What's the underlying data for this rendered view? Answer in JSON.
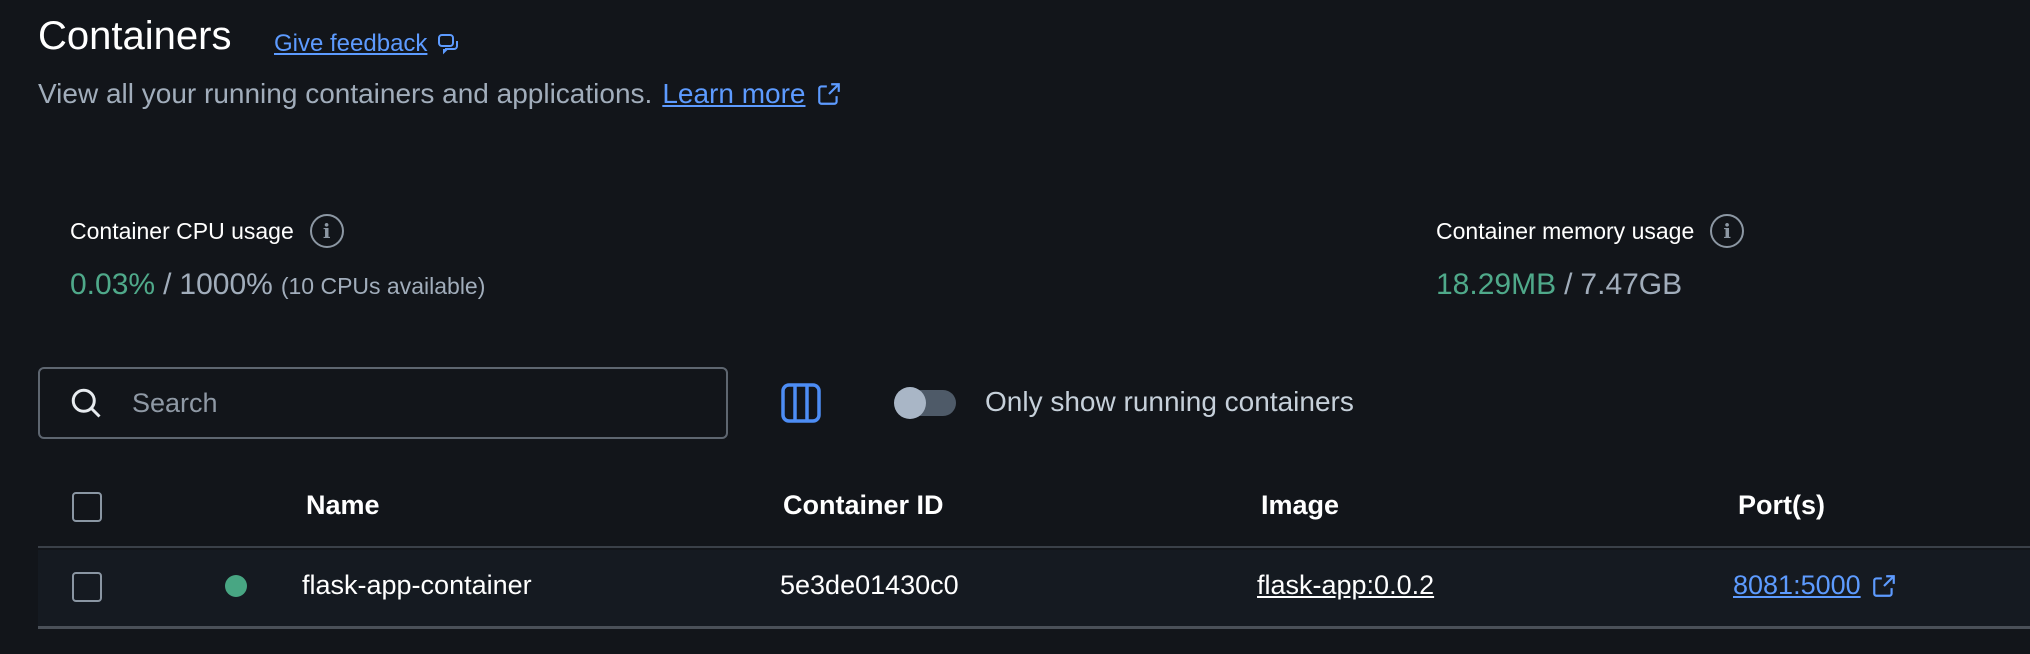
{
  "header": {
    "title": "Containers",
    "feedback_link": "Give feedback",
    "subtitle": "View all your running containers and applications.",
    "learn_more": "Learn more"
  },
  "stats": {
    "cpu": {
      "label": "Container CPU usage",
      "used": "0.03%",
      "separator": "/",
      "total": "1000%",
      "note": "(10 CPUs available)"
    },
    "memory": {
      "label": "Container memory usage",
      "used": "18.29MB",
      "separator": "/",
      "total": "7.47GB"
    }
  },
  "toolbar": {
    "search_placeholder": "Search",
    "search_value": "",
    "toggle_label": "Only show running containers",
    "toggle_on": false
  },
  "table": {
    "headers": {
      "name": "Name",
      "container_id": "Container ID",
      "image": "Image",
      "ports": "Port(s)"
    },
    "rows": [
      {
        "status": "running",
        "name": "flask-app-container",
        "container_id": "5e3de01430c0",
        "image": "flask-app:0.0.2",
        "ports": "8081:5000"
      }
    ]
  },
  "colors": {
    "background": "#12151a",
    "accent_link": "#5d9bff",
    "status_running": "#48a683",
    "usage_green": "#4fa98a"
  },
  "icons": {
    "feedback": "chat-feedback-icon",
    "external": "external-link-icon",
    "info": "info-icon",
    "search": "search-icon",
    "columns": "columns-icon"
  }
}
